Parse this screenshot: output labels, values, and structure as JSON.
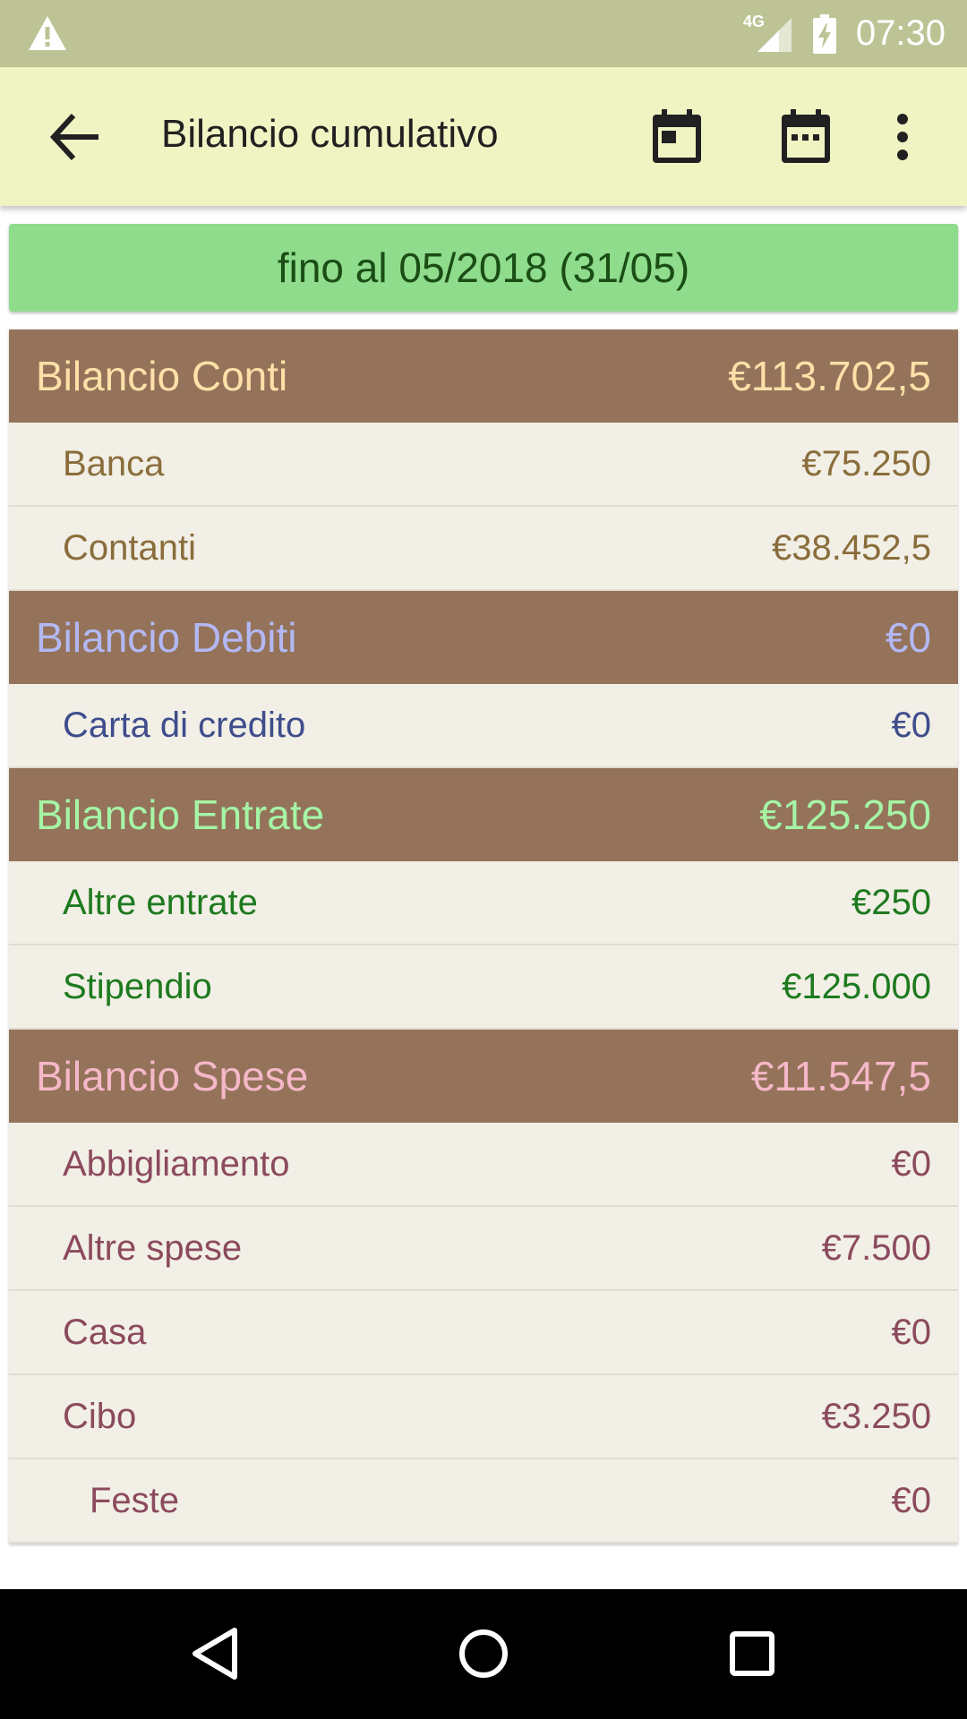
{
  "status_bar": {
    "network": "4G",
    "time": "07:30"
  },
  "app_bar": {
    "title": "Bilancio cumulativo"
  },
  "period": {
    "label": "fino al 05/2018 (31/05)"
  },
  "colors": {
    "status_bar": "#bdc394",
    "app_bar": "#f0f4c3",
    "period_bar": "#8fdc8c",
    "group_header": "#94735a",
    "row_bg": "#f1efe6"
  },
  "groups": [
    {
      "title": "Bilancio Conti",
      "total": "€113.702,5",
      "header_color": "#ffe0a8",
      "item_color": "#8a6d3b",
      "items": [
        {
          "name": "Banca",
          "amount": "€75.250"
        },
        {
          "name": "Contanti",
          "amount": "€38.452,5"
        }
      ]
    },
    {
      "title": "Bilancio Debiti",
      "total": "€0",
      "header_color": "#b3b8f5",
      "item_color": "#3f4d8c",
      "items": [
        {
          "name": "Carta di credito",
          "amount": "€0"
        }
      ]
    },
    {
      "title": "Bilancio Entrate",
      "total": "€125.250",
      "header_color": "#a6f5a6",
      "item_color": "#1e7a1e",
      "items": [
        {
          "name": "Altre entrate",
          "amount": "€250"
        },
        {
          "name": "Stipendio",
          "amount": "€125.000"
        }
      ]
    },
    {
      "title": "Bilancio Spese",
      "total": "€11.547,5",
      "header_color": "#f5b8c8",
      "item_color": "#8c4a5e",
      "items": [
        {
          "name": "Abbigliamento",
          "amount": "€0"
        },
        {
          "name": "Altre spese",
          "amount": "€7.500"
        },
        {
          "name": "Casa",
          "amount": "€0"
        },
        {
          "name": "Cibo",
          "amount": "€3.250"
        },
        {
          "name": "Feste",
          "amount": "€0",
          "sub": true
        }
      ]
    }
  ]
}
